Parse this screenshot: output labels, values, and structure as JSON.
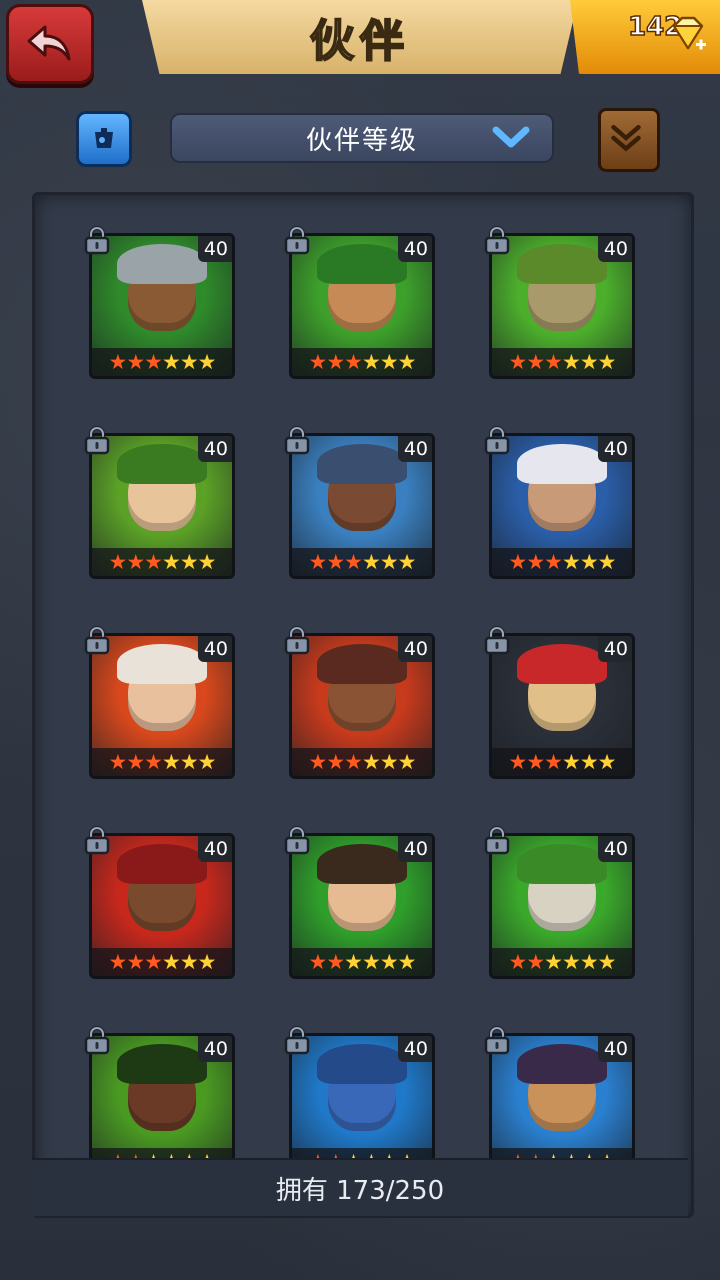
{
  "header": {
    "title": "伙伴",
    "gems": "142",
    "back_icon": "back-arrow-icon",
    "gem_icon": "diamond-icon"
  },
  "toolbar": {
    "sort_label": "伙伴等级",
    "filter_icon": "filter-icon",
    "collection_icon": "scroll-icon"
  },
  "colors": {
    "accent_gold": "#ffcb3a",
    "back_red": "#d83a3a",
    "panel_bg": "#333b4a"
  },
  "partners": [
    {
      "level": "40",
      "stars_on": 3,
      "stars_total": 6,
      "bg": "#2f8a2a",
      "skin": "#8a5a34",
      "hair": "#9aa3a8"
    },
    {
      "level": "40",
      "stars_on": 3,
      "stars_total": 6,
      "bg": "#3da02a",
      "skin": "#c58a55",
      "hair": "#2a7a25"
    },
    {
      "level": "40",
      "stars_on": 3,
      "stars_total": 6,
      "bg": "#4caf2b",
      "skin": "#a89a6a",
      "hair": "#5a8a2a"
    },
    {
      "level": "40",
      "stars_on": 3,
      "stars_total": 6,
      "bg": "#5ba126",
      "skin": "#e8c49a",
      "hair": "#3a7a20"
    },
    {
      "level": "40",
      "stars_on": 3,
      "stars_total": 6,
      "bg": "#3a80c0",
      "skin": "#7a4a32",
      "hair": "#3a4f70"
    },
    {
      "level": "40",
      "stars_on": 3,
      "stars_total": 6,
      "bg": "#2a5ea8",
      "skin": "#c89a78",
      "hair": "#e6e6ef"
    },
    {
      "level": "40",
      "stars_on": 3,
      "stars_total": 6,
      "bg": "#d8481c",
      "skin": "#e9c09e",
      "hair": "#e8e2d8"
    },
    {
      "level": "40",
      "stars_on": 3,
      "stars_total": 6,
      "bg": "#c83a1c",
      "skin": "#8a5434",
      "hair": "#5a2a20"
    },
    {
      "level": "40",
      "stars_on": 3,
      "stars_total": 6,
      "bg": "#2b2f38",
      "skin": "#e0c088",
      "hair": "#c8282a"
    },
    {
      "level": "40",
      "stars_on": 3,
      "stars_total": 6,
      "bg": "#c8281c",
      "skin": "#7a4a2e",
      "hair": "#8a1a1a"
    },
    {
      "level": "40",
      "stars_on": 2,
      "stars_total": 6,
      "bg": "#2f9e2a",
      "skin": "#e6bb92",
      "hair": "#3a2a1e"
    },
    {
      "level": "40",
      "stars_on": 2,
      "stars_total": 6,
      "bg": "#3aa82a",
      "skin": "#d8d2c2",
      "hair": "#3a8a28"
    },
    {
      "level": "40",
      "stars_on": 2,
      "stars_total": 6,
      "bg": "#4a9a22",
      "skin": "#6a3a26",
      "hair": "#1e3a14"
    },
    {
      "level": "40",
      "stars_on": 2,
      "stars_total": 6,
      "bg": "#1f78c8",
      "skin": "#3a68b8",
      "hair": "#244a8a"
    },
    {
      "level": "40",
      "stars_on": 2,
      "stars_total": 6,
      "bg": "#2a80d0",
      "skin": "#c8925a",
      "hair": "#3a2a4a"
    }
  ],
  "footer": {
    "owned_label": "拥有 173/250"
  }
}
